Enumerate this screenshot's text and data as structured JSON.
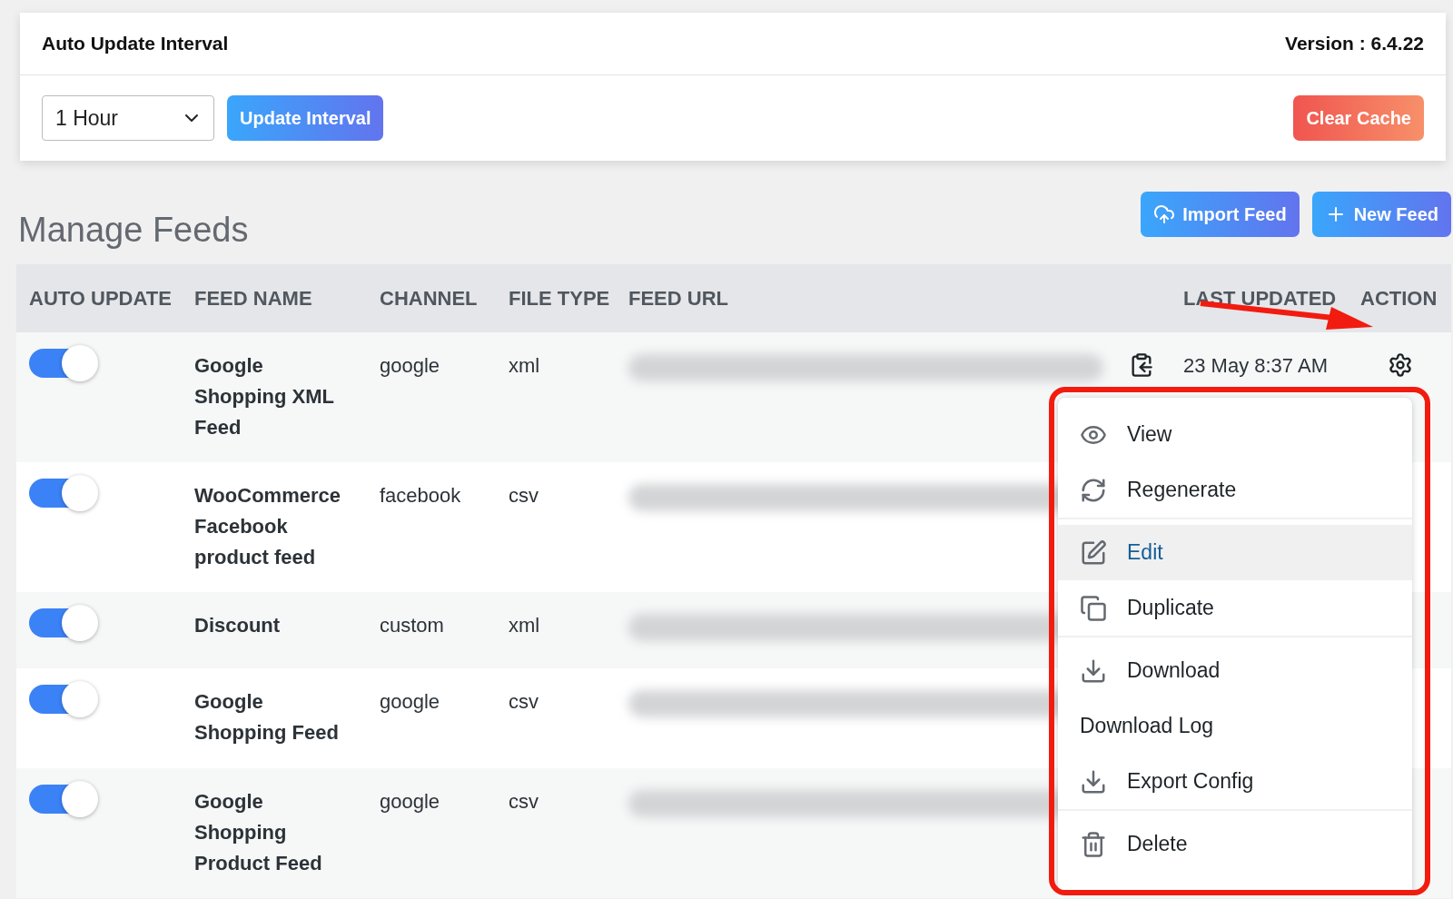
{
  "interval_card": {
    "title": "Auto Update Interval",
    "version": "Version : 6.4.22",
    "interval_select": {
      "value": "1 Hour"
    },
    "update_button": "Update Interval",
    "clear_cache_button": "Clear Cache"
  },
  "heading": "Manage Feeds",
  "actions": [
    {
      "kind": "import",
      "label": "Import Feed"
    },
    {
      "kind": "new",
      "label": "New Feed"
    }
  ],
  "table": {
    "columns": [
      "AUTO UPDATE",
      "FEED NAME",
      "CHANNEL",
      "FILE TYPE",
      "FEED URL",
      "LAST UPDATED",
      "ACTION"
    ],
    "rows": [
      {
        "auto_update": true,
        "feed_name": "Google Shopping XML Feed",
        "channel": "google",
        "file_type": "xml",
        "last_updated": "23 May 8:37 AM"
      },
      {
        "auto_update": true,
        "feed_name": "WooCommerce Facebook product feed",
        "channel": "facebook",
        "file_type": "csv"
      },
      {
        "auto_update": true,
        "feed_name": "Discount",
        "channel": "custom",
        "file_type": "xml"
      },
      {
        "auto_update": true,
        "feed_name": "Google Shopping Feed",
        "channel": "google",
        "file_type": "csv"
      },
      {
        "auto_update": true,
        "feed_name": "Google Shopping Product Feed",
        "channel": "google",
        "file_type": "csv"
      }
    ]
  },
  "action_menu": {
    "items": [
      {
        "kind": "view",
        "label": "View",
        "selected": false,
        "divider_after": false
      },
      {
        "kind": "regenerate",
        "label": "Regenerate",
        "selected": false,
        "divider_after": true
      },
      {
        "kind": "edit",
        "label": "Edit",
        "selected": true,
        "divider_after": false
      },
      {
        "kind": "duplicate",
        "label": "Duplicate",
        "selected": false,
        "divider_after": true
      },
      {
        "kind": "download",
        "label": "Download",
        "selected": false,
        "divider_after": false
      },
      {
        "kind": "log",
        "label": "Download Log",
        "selected": false,
        "divider_after": false
      },
      {
        "kind": "export",
        "label": "Export Config",
        "selected": false,
        "divider_after": true
      },
      {
        "kind": "delete",
        "label": "Delete",
        "selected": false,
        "divider_after": false
      }
    ]
  }
}
